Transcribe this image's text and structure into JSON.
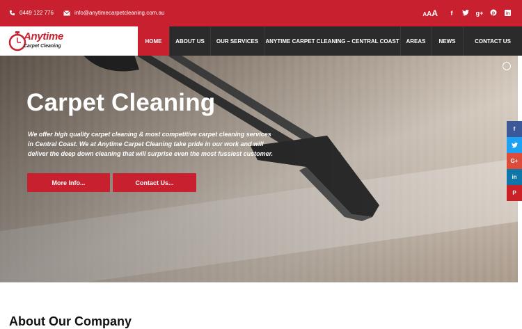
{
  "topbar": {
    "phone": "0449 122 776",
    "email": "info@anytimecarpetcleaning.com.au",
    "font_size_letters": [
      "A",
      "A",
      "A"
    ],
    "social": [
      {
        "name": "facebook-icon",
        "glyph": "f"
      },
      {
        "name": "twitter-icon",
        "glyph": "t"
      },
      {
        "name": "google-plus-icon",
        "glyph": "g+"
      },
      {
        "name": "pinterest-icon",
        "glyph": "p"
      },
      {
        "name": "linkedin-icon",
        "glyph": "in"
      }
    ]
  },
  "logo": {
    "title": "Anytime",
    "subtitle": "Carpet Cleaning"
  },
  "nav": {
    "items": [
      {
        "label": "HOME",
        "active": true
      },
      {
        "label": "ABOUT US",
        "active": false
      },
      {
        "label": "OUR SERVICES",
        "active": false
      },
      {
        "label": "ANYTIME CARPET CLEANING – CENTRAL COAST",
        "active": false
      },
      {
        "label": "AREAS",
        "active": false
      },
      {
        "label": "NEWS",
        "active": false
      },
      {
        "label": "CONTACT US",
        "active": false
      }
    ]
  },
  "hero": {
    "title": "Carpet Cleaning",
    "text": "We offer high quality carpet cleaning & most competitive carpet cleaning services in Central Coast. We at Anytime Carpet Cleaning take pride in our work and will deliver the deep down cleaning that will surprise even the most fussiest customer.",
    "buttons": {
      "more": "More Info...",
      "contact": "Contact Us..."
    }
  },
  "side_social": [
    {
      "name": "share-facebook-icon",
      "glyph": "f",
      "color": "#3b5998"
    },
    {
      "name": "share-twitter-icon",
      "glyph": "t",
      "color": "#1da1f2"
    },
    {
      "name": "share-google-plus-icon",
      "glyph": "G+",
      "color": "#dd4b39"
    },
    {
      "name": "share-linkedin-icon",
      "glyph": "in",
      "color": "#0e76a8"
    },
    {
      "name": "share-pinterest-icon",
      "glyph": "P",
      "color": "#cb2027"
    }
  ],
  "about": {
    "heading": "About Our Company"
  },
  "colors": {
    "brand_red": "#c8202e",
    "nav_dark": "#2b2b2b"
  }
}
